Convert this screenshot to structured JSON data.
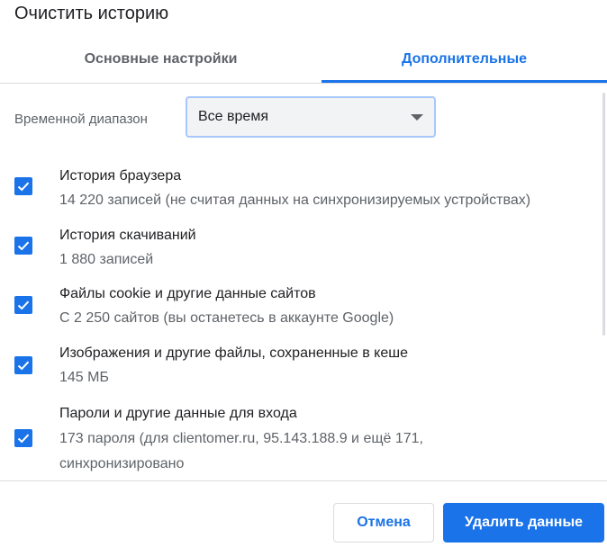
{
  "dialog": {
    "title": "Очистить историю"
  },
  "tabs": [
    {
      "label": "Основные настройки",
      "active": false
    },
    {
      "label": "Дополнительные",
      "active": true
    }
  ],
  "time_range": {
    "label": "Временной диапазон",
    "value": "Все время"
  },
  "items": [
    {
      "title": "История браузера",
      "description": "14 220 записей (не считая данных на синхронизируемых устройствах)",
      "checked": true
    },
    {
      "title": "История скачиваний",
      "description": "1 880 записей",
      "checked": true
    },
    {
      "title": "Файлы cookie и другие данные сайтов",
      "description": "С 2 250 сайтов (вы останетесь в аккаунте Google)",
      "checked": true
    },
    {
      "title": "Изображения и другие файлы, сохраненные в кеше",
      "description": "145 МБ",
      "checked": true
    },
    {
      "title": "Пароли и другие данные для входа",
      "description_line1": "173 пароля (для clientomer.ru, 95.143.188.9 и ещё 171,",
      "description_line2": "синхронизировано",
      "checked": true
    }
  ],
  "buttons": {
    "cancel": "Отмена",
    "delete": "Удалить данные"
  },
  "colors": {
    "accent": "#1a73e8",
    "text_primary": "#202124",
    "text_secondary": "#5f6368",
    "divider": "#dadce0"
  }
}
